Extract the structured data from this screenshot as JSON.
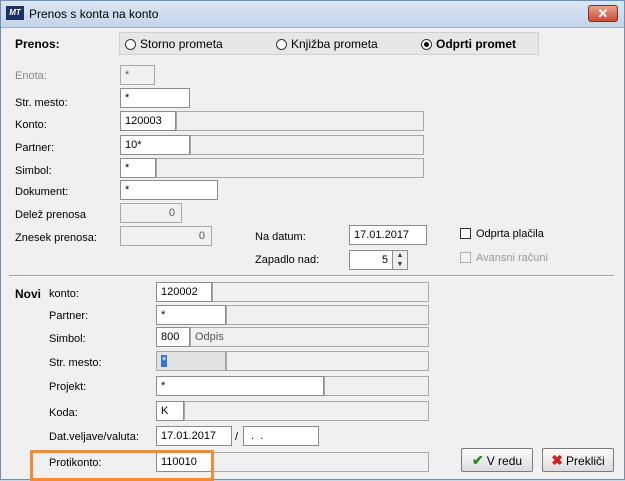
{
  "window": {
    "title": "Prenos s konta na konto",
    "icon_text": "MT",
    "close_label": "✕"
  },
  "prenos": {
    "label": "Prenos:",
    "options": [
      {
        "label": "Storno prometa",
        "selected": false
      },
      {
        "label": "Knjižba prometa",
        "selected": false
      },
      {
        "label": "Odprti promet",
        "selected": true
      }
    ]
  },
  "source": {
    "enota": {
      "label": "Enota:",
      "value": "*"
    },
    "str_mesto": {
      "label": "Str. mesto:",
      "value": "*"
    },
    "konto": {
      "label": "Konto:",
      "value": "120003",
      "desc": ""
    },
    "partner": {
      "label": "Partner:",
      "value": "10*",
      "desc": ""
    },
    "simbol": {
      "label": "Simbol:",
      "value": "*",
      "desc": ""
    },
    "dokument": {
      "label": "Dokument:",
      "value": "*"
    },
    "delez_prenosa": {
      "label": "Delež prenosa",
      "value": "0"
    },
    "znesek_prenosa": {
      "label": "Znesek prenosa:",
      "value": "0"
    },
    "na_datum": {
      "label": "Na datum:",
      "value": "17.01.2017"
    },
    "zapadlo_nad": {
      "label": "Zapadlo nad:",
      "value": "5"
    },
    "odprta_placila": {
      "label": "Odprta plačila",
      "checked": false
    },
    "avansni_racuni": {
      "label": "Avansni računi",
      "checked": false
    }
  },
  "novi": {
    "label": "Novi",
    "konto": {
      "label": "konto:",
      "value": "120002",
      "desc": ""
    },
    "partner": {
      "label": "Partner:",
      "value": "*",
      "desc": ""
    },
    "simbol": {
      "label": "Simbol:",
      "value": "800",
      "desc": "Odpis"
    },
    "str_mesto": {
      "label": "Str. mesto:",
      "value": "*",
      "desc": ""
    },
    "projekt": {
      "label": "Projekt:",
      "value": "*",
      "desc": ""
    },
    "koda": {
      "label": "Koda:",
      "value": "K",
      "desc": ""
    },
    "dat_veljave": {
      "label": "Dat.veljave/valuta:",
      "value": "17.01.2017",
      "sep": "/",
      "valuta": " .  ."
    },
    "protikonto": {
      "label": "Protikonto:",
      "value": "110010",
      "desc": ""
    }
  },
  "buttons": {
    "ok_label": "V redu",
    "cancel_label": "Prekliči"
  },
  "colors": {
    "highlight": "#f08b3a",
    "ok_icon": "#1f8f1f",
    "cancel_icon": "#d02020",
    "close_button": "#c74d36"
  }
}
